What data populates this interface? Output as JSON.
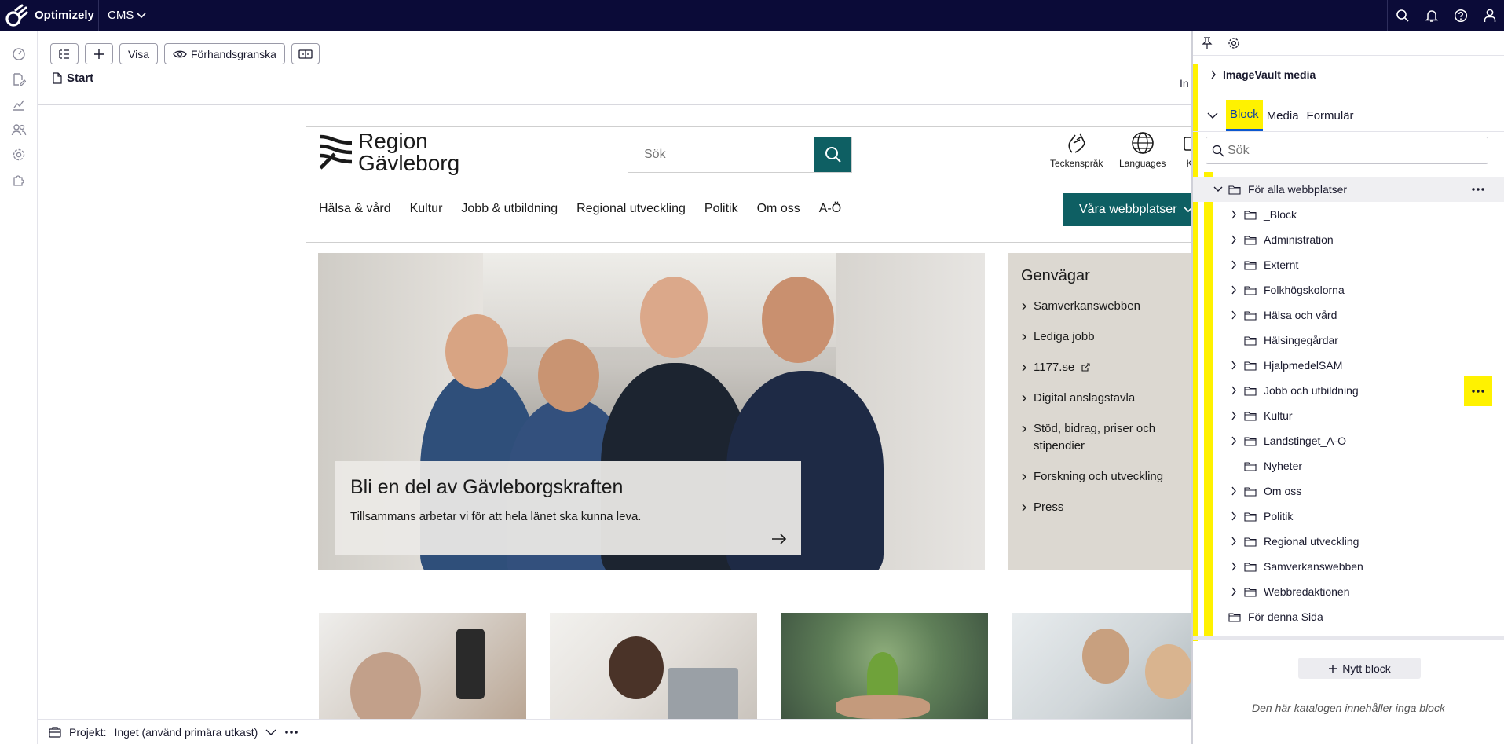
{
  "topbar": {
    "brand": "Optimizely",
    "product": "CMS"
  },
  "toolbar": {
    "view_label": "Visa",
    "preview_label": "Förhandsgranska"
  },
  "breadcrumb": {
    "page": "Start"
  },
  "cut_text": "In",
  "site": {
    "logo_line1": "Region",
    "logo_line2": "Gävleborg",
    "search_placeholder": "Sök",
    "utilities": [
      "Teckenspråk",
      "Languages",
      "Ko"
    ],
    "nav": [
      "Hälsa & vård",
      "Kultur",
      "Jobb & utbildning",
      "Regional utveckling",
      "Politik",
      "Om oss",
      "A-Ö"
    ],
    "our_sites": "Våra webbplatser",
    "hero_title": "Bli en del av Gävleborgskraften",
    "hero_text": "Tillsammans arbetar vi för att hela länet ska kunna leva.",
    "shortcuts_title": "Genvägar",
    "shortcuts": [
      "Samverkanswebben",
      "Lediga jobb",
      "1177.se",
      "Digital anslagstavla",
      "Stöd, bidrag, priser och stipendier",
      "Forskning och utveckling",
      "Press"
    ]
  },
  "panel": {
    "imagevault": "ImageVault media",
    "tabs": [
      "Block",
      "Media",
      "Formulär"
    ],
    "active_tab": "Block",
    "search_placeholder": "Sök",
    "root_folder": "För alla webbplatser",
    "folders": [
      {
        "name": "_Block",
        "expandable": true
      },
      {
        "name": "Administration",
        "expandable": true
      },
      {
        "name": "Externt",
        "expandable": true
      },
      {
        "name": "Folkhögskolorna",
        "expandable": true
      },
      {
        "name": "Hälsa och vård",
        "expandable": true
      },
      {
        "name": "Hälsingegårdar",
        "expandable": false
      },
      {
        "name": "HjalpmedelSAM",
        "expandable": true
      },
      {
        "name": "Jobb och utbildning",
        "expandable": true
      },
      {
        "name": "Kultur",
        "expandable": true
      },
      {
        "name": "Landstinget_A-O",
        "expandable": true
      },
      {
        "name": "Nyheter",
        "expandable": false
      },
      {
        "name": "Om oss",
        "expandable": true
      },
      {
        "name": "Politik",
        "expandable": true
      },
      {
        "name": "Regional utveckling",
        "expandable": true
      },
      {
        "name": "Samverkanswebben",
        "expandable": true
      },
      {
        "name": "Webbredaktionen",
        "expandable": true
      }
    ],
    "page_folder": "För denna Sida",
    "new_block": "Nytt block",
    "empty_message": "Den här katalogen innehåller inga block"
  },
  "project": {
    "label": "Projekt:",
    "value": "Inget (använd primära utkast)"
  },
  "colors": {
    "topbar": "#0b0b38",
    "highlight": "#fff200",
    "site_teal": "#0e5f63",
    "tab_accent": "#0b57d0"
  }
}
